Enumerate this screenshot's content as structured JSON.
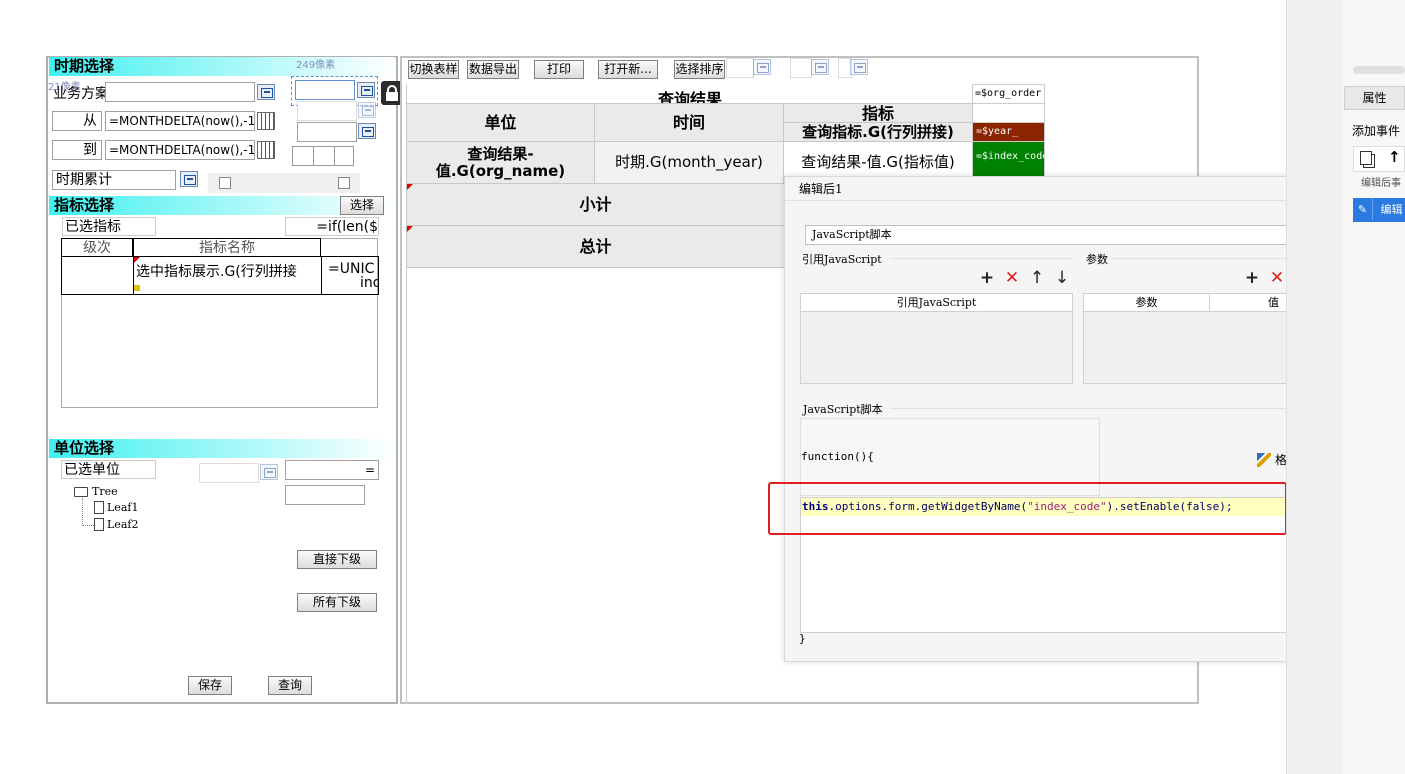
{
  "left": {
    "period_header": "时期选择",
    "ruler_px": "249像素",
    "ruler_side": "21像素",
    "business_label": "业务方案",
    "from_label": "从",
    "to_label": "到",
    "from_formula": "=MONTHDELTA(now(),-1)",
    "to_formula": "=MONTHDELTA(now(),-1)",
    "period_accum_label": "时期累计",
    "indicator_header": "指标选择",
    "select_button": "选择",
    "selected_indicator_label": "已选指标",
    "selected_indicator_formula": "=if(len($",
    "col_level": "级次",
    "col_name": "指标名称",
    "cell_name": "选中指标展示.G(行列拼接",
    "cell_unic": "=UNIC",
    "cell_unic2": "ind",
    "unit_header": "单位选择",
    "selected_unit_label": "已选单位",
    "unit_formula": "=",
    "tree_root": "Tree",
    "tree_leaf1": "Leaf1",
    "tree_leaf2": "Leaf2",
    "direct_sub_button": "直接下级",
    "all_sub_button": "所有下级",
    "save_button": "保存",
    "query_button": "查询"
  },
  "toolbar": {
    "switch_style": "切换表样",
    "export": "数据导出",
    "print": "打印",
    "open_new": "打开新...",
    "select_sort": "选择排序"
  },
  "report": {
    "title": "查询结果",
    "org_order": "=$org_order",
    "unit_header": "单位",
    "time_header": "时间",
    "indicator_header": "指标",
    "indicator_query": "查询指标.G(行列拼接)",
    "year_cell": "=$year_",
    "index_cell": "=$index_code?",
    "org_value": "查询结果-值.G(org_name)",
    "month_value": "时期.G(month_year)",
    "indicator_value": "查询结果-值.G(指标值)",
    "subtotal": "小计",
    "total": "总计"
  },
  "dialog": {
    "title": "编辑后1",
    "type_select": "JavaScript脚本",
    "ref_js_section": "引用JavaScript",
    "params_section": "参数",
    "ref_js_col": "引用JavaScript",
    "param_col": "参数",
    "value_col": "值",
    "script_section": "JavaScript脚本",
    "format_code": "格式化代码",
    "fn_open": "function(){",
    "code_this": "this",
    "code_mid": ".options.form.getWidgetByName(",
    "code_str": "\"index_code\"",
    "code_call": ").setEnable(",
    "code_false": "false",
    "code_end": ");",
    "fn_close": "}"
  },
  "right_panel": {
    "properties_tab": "属性",
    "add_event": "添加事件",
    "event_item": "编辑后事",
    "edit_label": "编辑"
  },
  "colors": {
    "header_cyan": "#40f0f0",
    "year_cell_bg": "#8b2500",
    "index_cell_bg": "#008000",
    "highlight_line": "#ffffc0",
    "red_box": "#e02020",
    "selected_event": "#2a7ae2"
  }
}
